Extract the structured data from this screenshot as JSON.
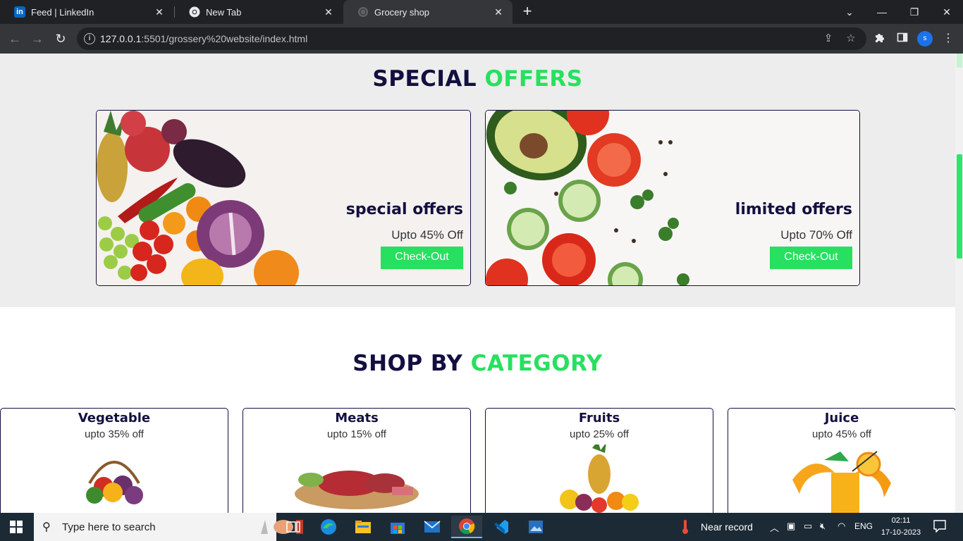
{
  "browser": {
    "tabs": [
      {
        "title": "Feed | LinkedIn",
        "icon": "linkedin-icon"
      },
      {
        "title": "New Tab",
        "icon": "chrome-icon"
      },
      {
        "title": "Grocery shop",
        "icon": "globe-icon"
      }
    ],
    "new_tab": "+",
    "url_host": "127.0.0.1",
    "url_rest": ":5501/grossery%20website/index.html",
    "profile_initial": "s"
  },
  "page": {
    "offers_heading": {
      "main": "SPECIAL",
      "accent": "OFFERS"
    },
    "offers": [
      {
        "title": "special offers",
        "subtitle": "Upto 45% Off",
        "button": "Check-Out"
      },
      {
        "title": "limited offers",
        "subtitle": "Upto 70% Off",
        "button": "Check-Out"
      }
    ],
    "category_heading": {
      "main": "SHOP BY",
      "accent": "CATEGORY"
    },
    "categories": [
      {
        "name": "Vegetable",
        "discount": "upto 35% off"
      },
      {
        "name": "Meats",
        "discount": "upto 15% off"
      },
      {
        "name": "Fruits",
        "discount": "upto 25% off"
      },
      {
        "name": "Juice",
        "discount": "upto 45% off"
      }
    ],
    "colors": {
      "accent": "#27e05f",
      "dark": "#130f40"
    }
  },
  "taskbar": {
    "search_placeholder": "Type here to search",
    "weather_text": "Near record",
    "language": "ENG",
    "time": "02:11",
    "date": "17-10-2023"
  }
}
